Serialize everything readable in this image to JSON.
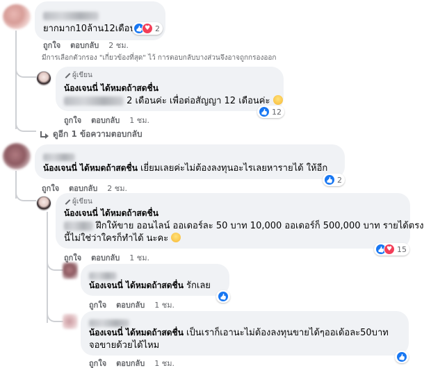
{
  "actions": {
    "like": "ถูกใจ",
    "reply": "ตอบกลับ"
  },
  "author_badge": "ผู้เขียน",
  "page_name": "น้องเจนนี่ ได้หมดถ้าสดชื่น",
  "comments": [
    {
      "id": "c1",
      "text": "ยากมาก10ล้าน12เดือน",
      "time": "2 ชม.",
      "reactions": {
        "types": [
          "like",
          "love"
        ],
        "count": "2"
      }
    },
    {
      "id": "c1r1",
      "text_tail": "2 เดือนค่ะ เพื่อต่อสัญญา 12 เดือนค่ะ",
      "emoji": "smile",
      "time": "1 ชม.",
      "reactions": {
        "types": [
          "like"
        ],
        "count": "12"
      }
    },
    {
      "id": "c2",
      "name": "น้องเจนนี่ ได้หมดถ้าสดชื่น",
      "text": "เยี่ยมเลยค่ะไม่ต้องลงทุนอะไรเลยหารายได้ ให้อีก",
      "time": "2 ชม.",
      "reactions": {
        "types": [
          "like"
        ],
        "count": "2"
      }
    },
    {
      "id": "c2r1",
      "text_line1": "ฝึกให้ขาย ออนไลน์ ออเดอร์ละ 50 บาท 10,000 ออเดอร์ก็ 500,000 บาท รายได้ตรง",
      "text_line2": "นี้ไม่ใช่ว่าใครก็ทำได้ นะคะ",
      "emoji": "heart-eyes",
      "time": "1 ชม.",
      "reactions": {
        "types": [
          "like",
          "love"
        ],
        "count": "15"
      }
    },
    {
      "id": "c2r2",
      "name": "น้องเจนนี่ ได้หมดถ้าสดชื่น",
      "text": "รักเลย",
      "time": "1 ชม.",
      "reactions": {
        "types": [
          "like"
        ],
        "count": ""
      }
    },
    {
      "id": "c2r3",
      "name": "น้องเจนนี่ ได้หมดถ้าสดชื่น",
      "text_line1": "เป็นเราก็เอานะไม่ต้องลงทุนขายได้ๆออเด้อละ50บาท",
      "text_line2": "จอขายด้วยได้ไหม",
      "time": "1 ชม.",
      "reactions": {
        "types": [
          "like"
        ],
        "count": ""
      }
    }
  ],
  "filter_note": "มีการเลือกตัวกรอง \"เกี่ยวข้องที่สุด\" ไว้ การตอบกลับบางส่วนจึงอาจถูกกรองออก",
  "view_more_replies": "ดูอีก 1 ข้อความตอบกลับ",
  "colors": {
    "bubble": "#f0f2f5",
    "like": "#1877f2",
    "love": "#f33e58",
    "meta": "#65676b"
  }
}
